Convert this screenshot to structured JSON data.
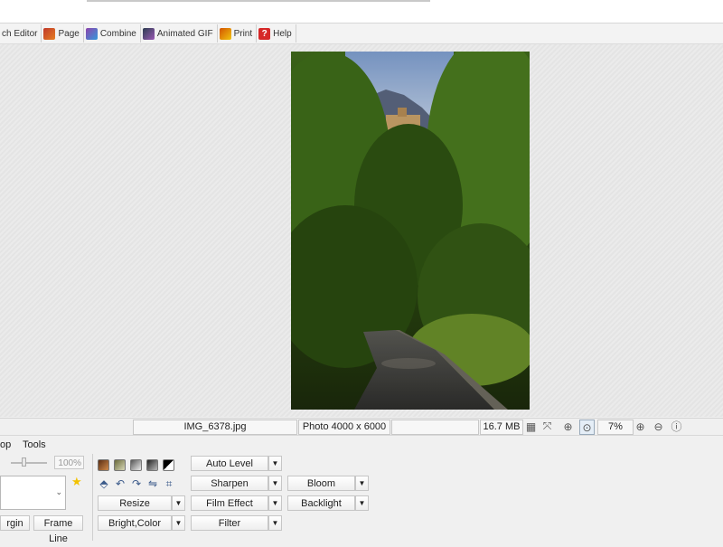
{
  "toolbar": {
    "items": [
      {
        "label": "ch Editor",
        "icon": "batch-editor-icon"
      },
      {
        "label": "Page",
        "icon": "page-icon"
      },
      {
        "label": "Combine",
        "icon": "combine-icon"
      },
      {
        "label": "Animated GIF",
        "icon": "animated-gif-icon"
      },
      {
        "label": "Print",
        "icon": "print-icon"
      },
      {
        "label": "Help",
        "icon": "help-icon"
      }
    ]
  },
  "status": {
    "filename": "IMG_6378.jpg",
    "info": "Photo 4000 x 6000",
    "empty": "",
    "size": "16.7 MB",
    "zoom": "7%"
  },
  "panel": {
    "menu": [
      "op",
      "Tools"
    ],
    "opacity": "100%",
    "margin_label": "rgin",
    "frame_line_label": "Frame Line",
    "buttons": {
      "auto_level": "Auto Level",
      "sharpen": "Sharpen",
      "bloom": "Bloom",
      "resize": "Resize",
      "film_effect": "Film Effect",
      "backlight": "Backlight",
      "bright_color": "Bright,Color",
      "filter": "Filter"
    }
  },
  "colors": {
    "canvas_bg": "#e8e8e8",
    "help_icon": "#d62828",
    "favorite_star": "#f2c200"
  }
}
